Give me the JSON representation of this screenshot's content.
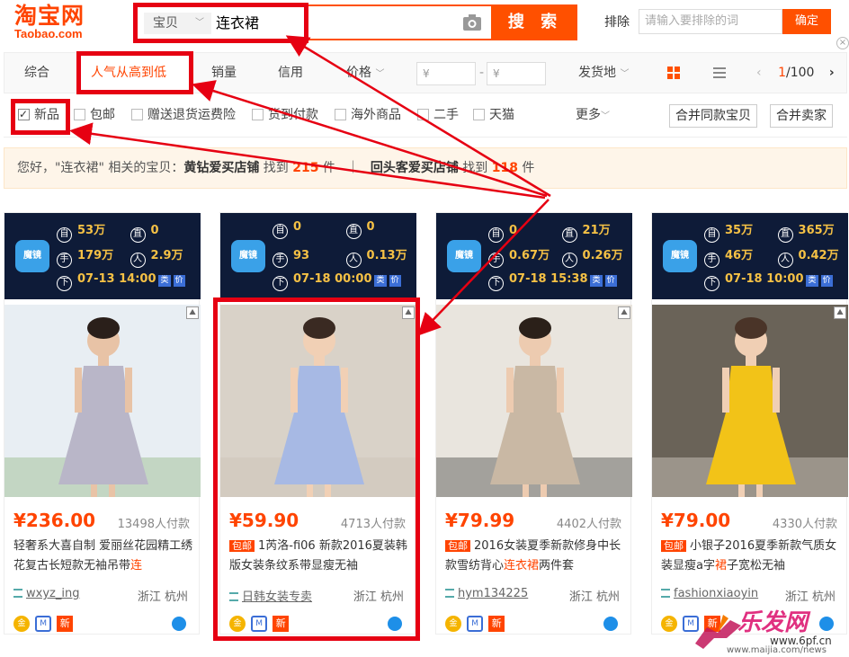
{
  "header": {
    "logo_cn": "淘宝网",
    "logo_en": "Taobao.com",
    "search_scope": "宝贝",
    "search_query": "连衣裙",
    "search_button": "搜 索",
    "exclude_label": "排除",
    "exclude_placeholder": "请输入要排除的词",
    "confirm_button": "确定"
  },
  "sortbar": {
    "items": [
      "综合",
      "人气从高到低",
      "销量",
      "信用",
      "价格"
    ],
    "price_min": "¥",
    "price_dash": "-",
    "price_max": "¥",
    "ship_from": "发货地",
    "page_current": "1",
    "page_total": "/100"
  },
  "filters": {
    "items": [
      "新品",
      "包邮",
      "赠送退货运费险",
      "货到付款",
      "海外商品",
      "二手",
      "天猫"
    ],
    "more": "更多",
    "merge_same": "合并同款宝贝",
    "merge_sellers": "合并卖家"
  },
  "tip": {
    "hello": "您好，",
    "query_quoted": "\"连衣裙\"",
    "related": " 相关的宝贝：",
    "shop1": "黄钻爱买店铺",
    "found": " 找到 ",
    "count1": "215",
    "unit": " 件",
    "sep": "｜",
    "shop2": "回头客爱买店铺",
    "count2": "118"
  },
  "products": [
    {
      "stats": {
        "zi": "53万",
        "zhi": "0",
        "shou": "179万",
        "ren": "2.9万",
        "time": "07-13 14:00"
      },
      "price": "¥236.00",
      "sold": "13498人付款",
      "baoyou": "",
      "title_a": "轻奢系大喜自制 爱丽丝花园精工绣花复古长短款无袖吊带",
      "title_hl": "连",
      "shop": "wxyz_ing",
      "location": "浙江 杭州"
    },
    {
      "stats": {
        "zi": "0",
        "zhi": "0",
        "shou": "93",
        "ren": "0.13万",
        "time": "07-18 00:00"
      },
      "price": "¥59.90",
      "sold": "4713人付款",
      "baoyou": "包邮",
      "title_a": "1芮洛-fi06 新款2016夏装韩版女装条纹系带显瘦无袖",
      "title_hl": "",
      "shop": "日韩女装专卖",
      "location": "浙江 杭州"
    },
    {
      "stats": {
        "zi": "0",
        "zhi": "21万",
        "shou": "0.67万",
        "ren": "0.26万",
        "time": "07-18 15:38"
      },
      "price": "¥79.99",
      "sold": "4402人付款",
      "baoyou": "包邮",
      "title_a": "2016女装夏季新款修身中长款雪纺背心",
      "title_hl": "连衣裙",
      "title_b": "两件套",
      "shop": "hym134225",
      "location": "浙江 杭州"
    },
    {
      "stats": {
        "zi": "35万",
        "zhi": "365万",
        "shou": "46万",
        "ren": "0.42万",
        "time": "07-18 10:00"
      },
      "price": "¥79.00",
      "sold": "4330人付款",
      "baoyou": "包邮",
      "title_a": "小银子2016夏季新款气质女装显瘦a字",
      "title_hl": "裙",
      "title_b": "子宽松无袖",
      "shop": "fashionxiaoyin",
      "location": "浙江 杭州"
    }
  ],
  "stat_icons": {
    "zi": "自",
    "zhi": "直",
    "shou": "手",
    "ren": "人",
    "xia": "下",
    "lei": "类",
    "jia": "价"
  },
  "card_misc": {
    "mojing": "魔镜",
    "gold_label": "金",
    "new_label": "新",
    "wm_corner": "⛰"
  },
  "watermark": {
    "brand": "乐发网",
    "url1": "www.6pf.cn",
    "url2": "www.maijia.com/news"
  },
  "colors": {
    "accent": "#ff5000",
    "highlight": "#e60012",
    "stats_bg": "#0e1b38",
    "stats_text": "#f5c145"
  }
}
